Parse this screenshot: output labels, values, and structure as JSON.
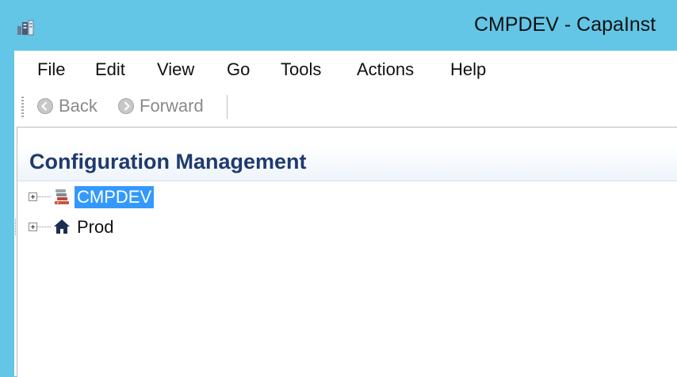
{
  "window": {
    "title": "CMPDEV - CapaInst"
  },
  "menu": {
    "items": [
      "File",
      "Edit",
      "View",
      "Go",
      "Tools",
      "Actions",
      "Help"
    ]
  },
  "toolbar": {
    "back_label": "Back",
    "forward_label": "Forward"
  },
  "panel": {
    "title": "Configuration Management"
  },
  "tree": {
    "nodes": [
      {
        "label": "CMPDEV",
        "icon": "server-stack-icon",
        "selected": true
      },
      {
        "label": "Prod",
        "icon": "home-icon",
        "selected": false
      }
    ]
  },
  "colors": {
    "titlebar": "#63c6e6",
    "selection": "#3399ff",
    "panel_title": "#1f3a6e"
  }
}
